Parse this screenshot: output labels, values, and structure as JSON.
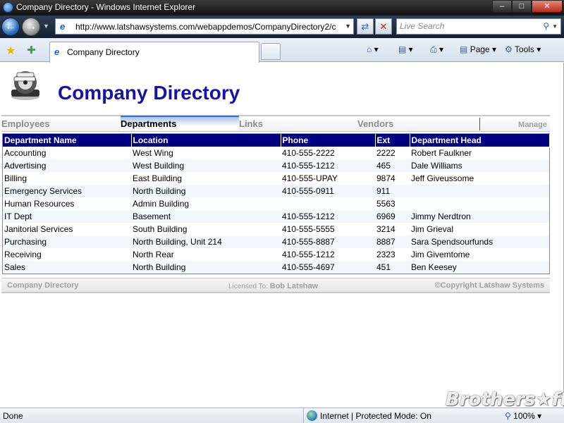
{
  "window": {
    "title": "Company Directory - Windows Internet Explorer",
    "minimize": "–",
    "maximize": "□",
    "close": "✕"
  },
  "nav": {
    "url": "http://www.latshawsystems.com/webappdemos/CompanyDirectory2/c",
    "search_placeholder": "Live Search"
  },
  "tab": {
    "label": "Company Directory"
  },
  "commands": {
    "page": "Page",
    "tools": "Tools"
  },
  "page": {
    "title": "Company Directory",
    "menu": {
      "items": [
        "Employees",
        "Departments",
        "Links",
        "Vendors"
      ],
      "active": "Departments",
      "manage": "Manage"
    },
    "table": {
      "columns": [
        "Department Name",
        "Location",
        "Phone",
        "Ext",
        "Department Head"
      ],
      "rows": [
        [
          "Accounting",
          "West Wing",
          "410-555-2222",
          "2222",
          "Robert Faulkner"
        ],
        [
          "Advertising",
          "West Building",
          "410-555-1212",
          "465",
          "Dale Williams"
        ],
        [
          "Billing",
          "East Building",
          "410-555-UPAY",
          "9874",
          "Jeff Giveussome"
        ],
        [
          "Emergency Services",
          "North Building",
          "410-555-0911",
          "911",
          ""
        ],
        [
          "Human Resources",
          "Admin Building",
          "",
          "5563",
          ""
        ],
        [
          "IT Dept",
          "Basement",
          "410-555-1212",
          "6969",
          "Jimmy Nerdtron"
        ],
        [
          "Janitorial Services",
          "South Building",
          "410-555-5555",
          "3214",
          "Jim Grieval"
        ],
        [
          "Purchasing",
          "North Building, Unit 214",
          "410-555-8887",
          "8887",
          "Sara Spendsourfunds"
        ],
        [
          "Receiving",
          "North Rear",
          "410-555-1212",
          "2323",
          "Jim Givemtome"
        ],
        [
          "Sales",
          "North Building",
          "410-555-4697",
          "451",
          "Ben Keesey"
        ]
      ]
    },
    "footer": {
      "left": "Company Directory",
      "licensed_label": "Licensed To:",
      "licensed_to": "Bob Latshaw",
      "copyright": "©Copyright Latshaw Systems"
    }
  },
  "status": {
    "text": "Done",
    "zone": "Internet | Protected Mode: On",
    "zoom": "100%"
  },
  "watermark": "Brothers★ft"
}
